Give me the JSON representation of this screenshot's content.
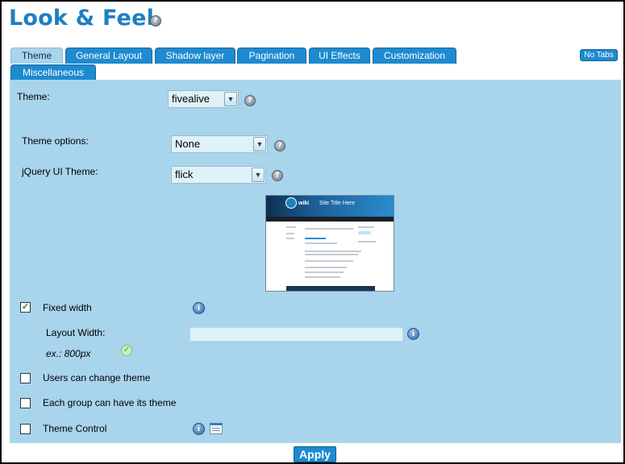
{
  "header": {
    "title": "Look & Feel",
    "help_glyph": "?"
  },
  "tabs": [
    {
      "label": "Theme",
      "active": true
    },
    {
      "label": "General Layout",
      "active": false
    },
    {
      "label": "Shadow layer",
      "active": false
    },
    {
      "label": "Pagination",
      "active": false
    },
    {
      "label": "UI Effects",
      "active": false
    },
    {
      "label": "Customization",
      "active": false
    },
    {
      "label": "Miscellaneous",
      "active": false
    }
  ],
  "no_tabs_label": "No Tabs",
  "theme": {
    "label": "Theme:",
    "value": "fivealive",
    "options_label": "Theme options:",
    "options_value": "None",
    "jquery_label": "jQuery UI Theme:",
    "jquery_value": "flick"
  },
  "preview": {
    "site_title": "Site Title Here",
    "logo_text": "wiki"
  },
  "fixed_width": {
    "label": "Fixed width",
    "checked": true,
    "layout_width_label": "Layout Width:",
    "layout_width_value": "",
    "hint": "ex.: 800px"
  },
  "options": {
    "users_change_theme": {
      "label": "Users can change theme",
      "checked": false
    },
    "group_theme": {
      "label": "Each group can have its theme",
      "checked": false
    },
    "theme_control": {
      "label": "Theme Control",
      "checked": false
    }
  },
  "apply_label": "Apply",
  "colors": {
    "accent": "#1e8ad0",
    "title": "#1d7fc2",
    "panel": "#a8d4ec"
  },
  "icons": [
    "help-icon",
    "info-icon",
    "ok-icon",
    "calendar-icon",
    "chevron-down-icon"
  ]
}
